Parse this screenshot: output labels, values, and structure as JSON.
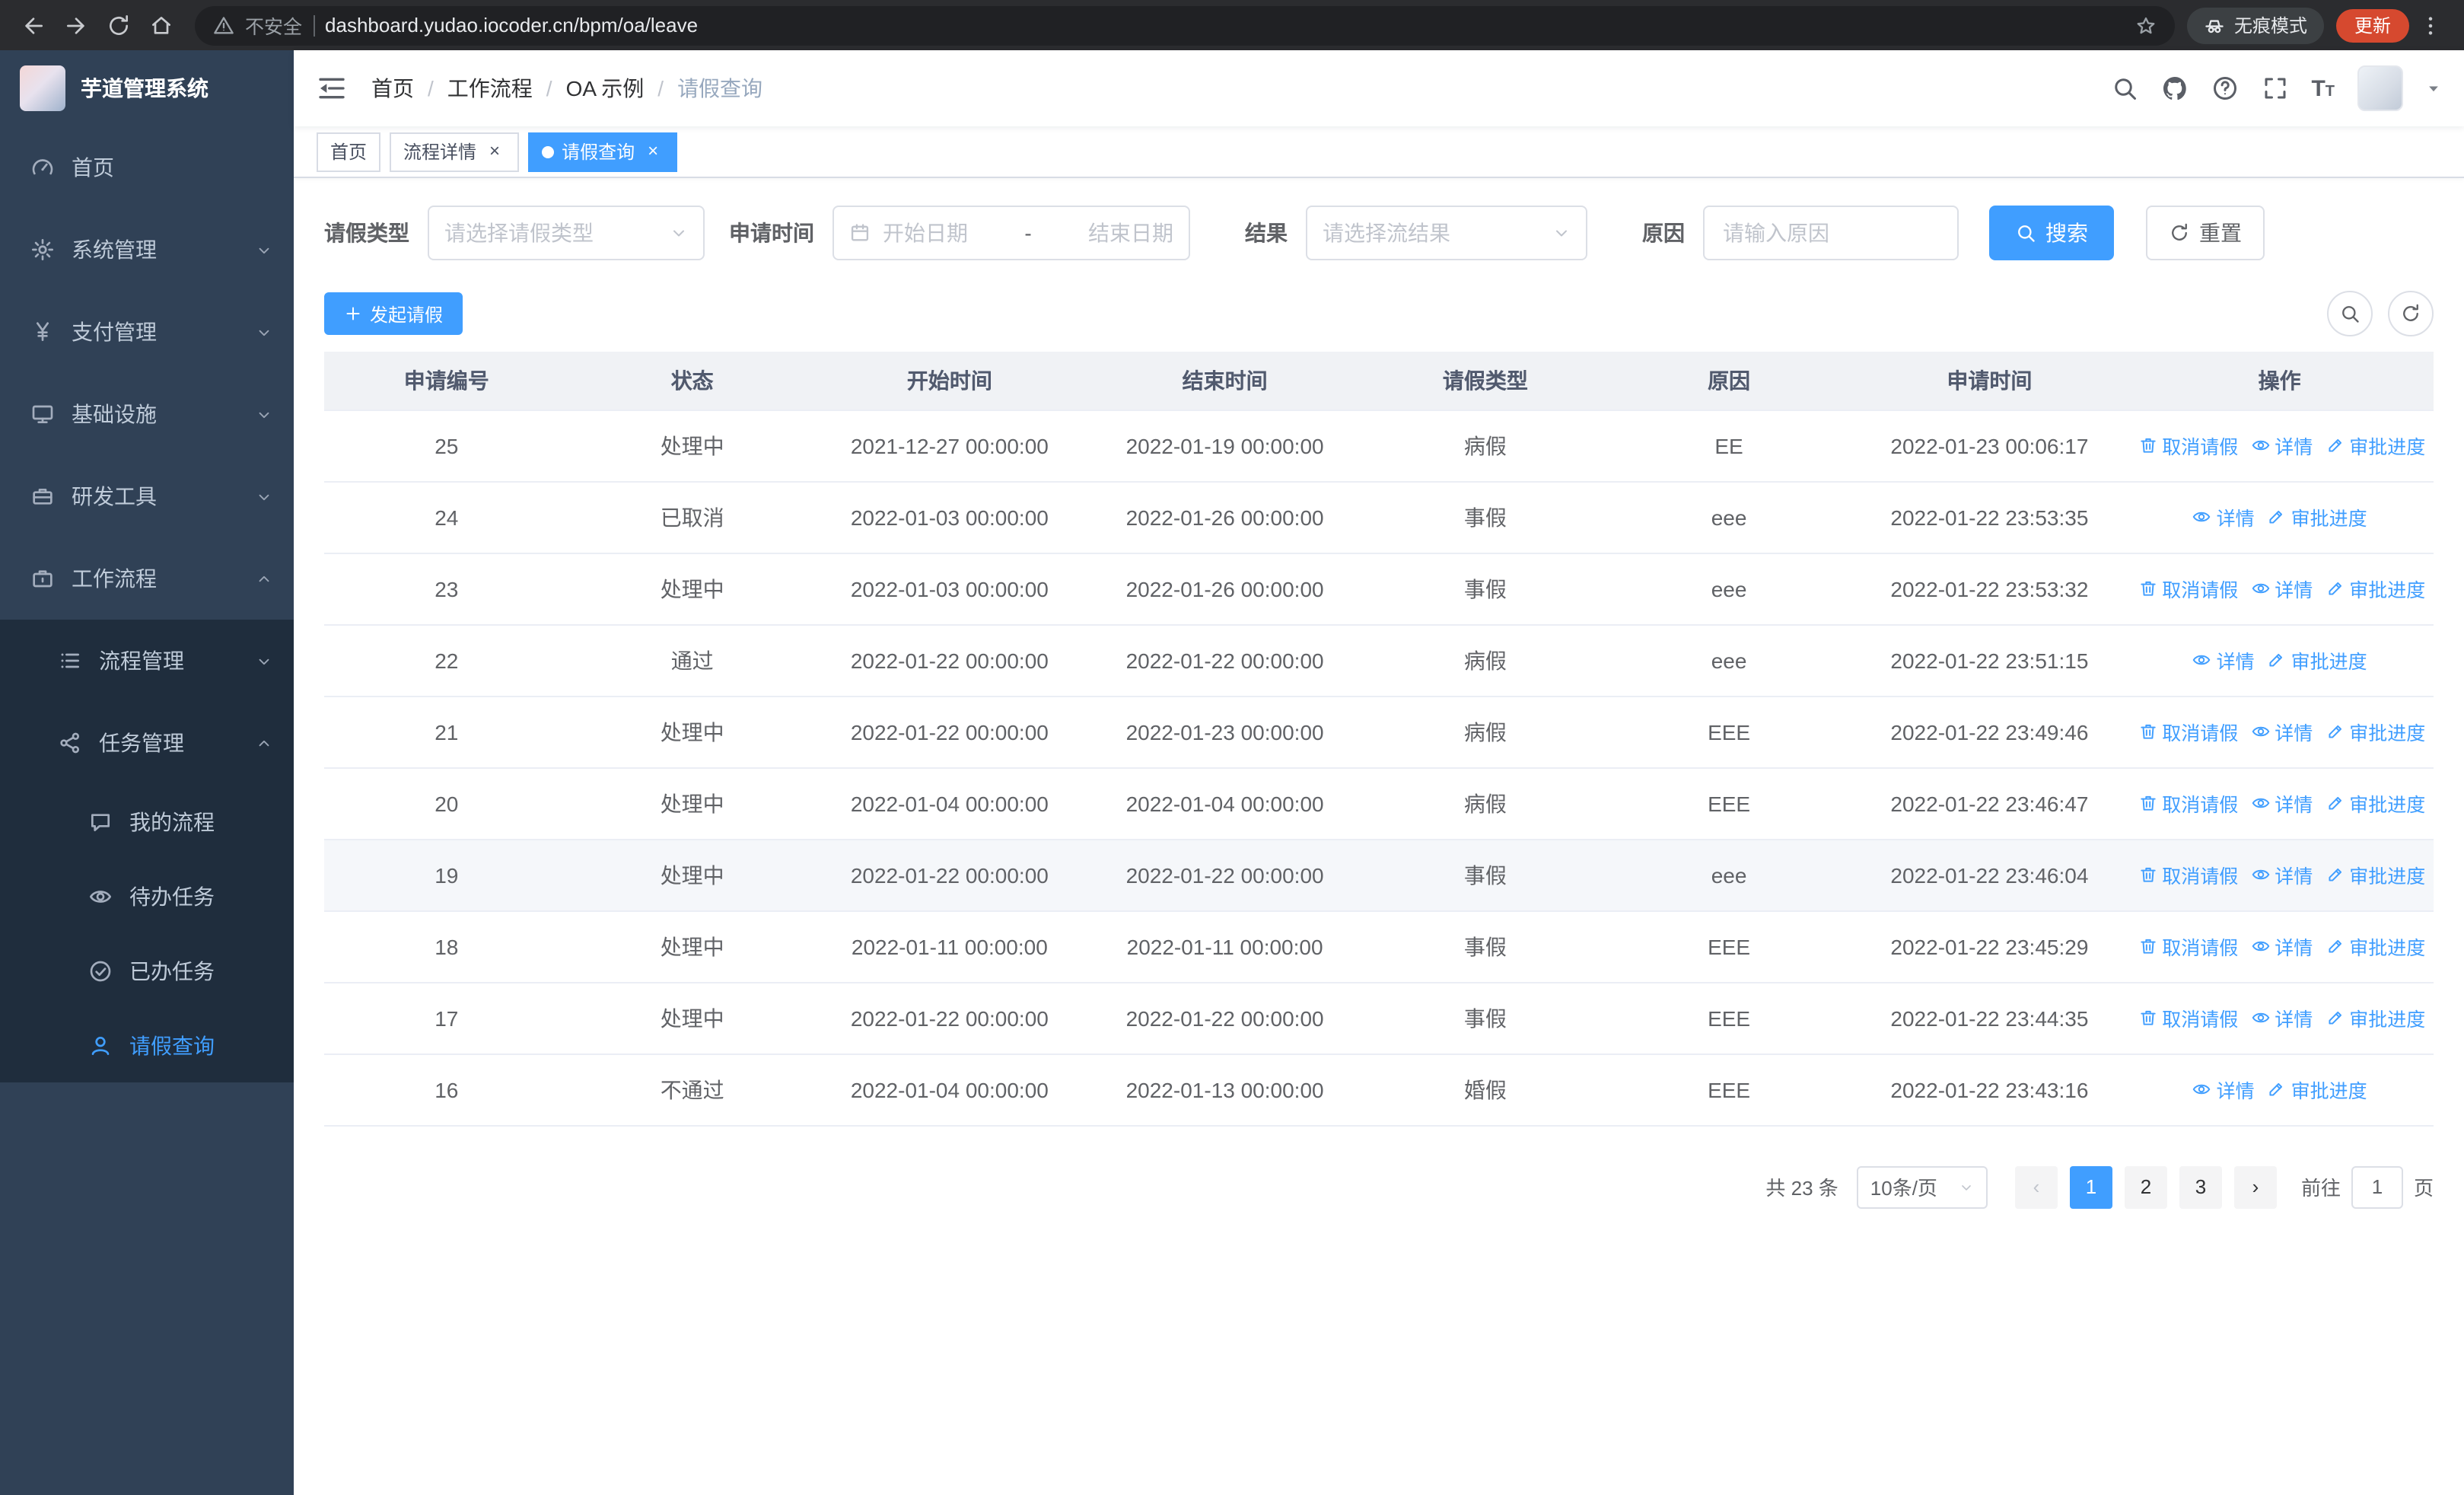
{
  "browser": {
    "security_label": "不安全",
    "url": "dashboard.yudao.iocoder.cn/bpm/oa/leave",
    "incognito_label": "无痕模式",
    "update_label": "更新"
  },
  "glyphs": {
    "close": "×",
    "breadcrumb_separator": "/",
    "prev_page": "‹",
    "next_page": "›",
    "font_size_large": "T",
    "font_size_small": "T"
  },
  "colors": {
    "accent": "#409EFF",
    "sidebar_bg": "#304156",
    "submenu_bg": "#1f2d3d",
    "update_pill_bg": "#d6492f",
    "table_header_bg": "#f0f2f5"
  },
  "icons": {
    "browser": [
      "back-arrow-icon",
      "forward-arrow-icon",
      "reload-icon",
      "home-icon",
      "warning-triangle-icon",
      "bookmark-star-icon",
      "incognito-icon",
      "kebab-menu-icon"
    ],
    "navbar": [
      "sidebar-toggle-icon",
      "search-icon",
      "github-icon",
      "question-icon",
      "fullscreen-icon",
      "font-size-icon",
      "chevron-down-icon"
    ],
    "table_actions": [
      "trash-icon",
      "eye-icon",
      "edit-icon"
    ]
  },
  "sidebar": {
    "title": "芋道管理系统",
    "items": [
      {
        "label": "首页",
        "icon": "dashboard-icon"
      },
      {
        "label": "系统管理",
        "icon": "gear-icon"
      },
      {
        "label": "支付管理",
        "icon": "yen-icon"
      },
      {
        "label": "基础设施",
        "icon": "monitor-icon"
      },
      {
        "label": "研发工具",
        "icon": "toolbox-icon"
      },
      {
        "label": "工作流程",
        "icon": "briefcase-icon",
        "expanded": true
      }
    ],
    "workflow_children": [
      {
        "label": "流程管理",
        "icon": "list-icon"
      },
      {
        "label": "任务管理",
        "icon": "share-icon",
        "expanded": true
      }
    ],
    "task_children": [
      {
        "label": "我的流程",
        "icon": "chat-icon"
      },
      {
        "label": "待办任务",
        "icon": "eye-icon"
      },
      {
        "label": "已办任务",
        "icon": "check-circle-icon"
      },
      {
        "label": "请假查询",
        "icon": "user-icon",
        "active": true
      }
    ]
  },
  "header": {
    "breadcrumb": [
      "首页",
      "工作流程",
      "OA 示例",
      "请假查询"
    ]
  },
  "tabs": [
    {
      "label": "首页",
      "closable": false,
      "active": false
    },
    {
      "label": "流程详情",
      "closable": true,
      "active": false
    },
    {
      "label": "请假查询",
      "closable": true,
      "active": true
    }
  ],
  "filters": {
    "leave_type_label": "请假类型",
    "leave_type_placeholder": "请选择请假类型",
    "apply_time_label": "申请时间",
    "start_date_placeholder": "开始日期",
    "range_separator": "-",
    "end_date_placeholder": "结束日期",
    "result_label": "结果",
    "result_placeholder": "请选择流结果",
    "reason_label": "原因",
    "reason_placeholder": "请输入原因",
    "search_button": "搜索",
    "reset_button": "重置"
  },
  "toolbar": {
    "create_button": "发起请假"
  },
  "table": {
    "columns": [
      "申请编号",
      "状态",
      "开始时间",
      "结束时间",
      "请假类型",
      "原因",
      "申请时间",
      "操作"
    ],
    "actions": {
      "cancel": "取消请假",
      "detail": "详情",
      "progress": "审批进度"
    },
    "rows": [
      {
        "id": "25",
        "status": "处理中",
        "start": "2021-12-27 00:00:00",
        "end": "2022-01-19 00:00:00",
        "type": "病假",
        "reason": "EE",
        "applied": "2022-01-23 00:06:17",
        "cancellable": true,
        "highlighted": false
      },
      {
        "id": "24",
        "status": "已取消",
        "start": "2022-01-03 00:00:00",
        "end": "2022-01-26 00:00:00",
        "type": "事假",
        "reason": "eee",
        "applied": "2022-01-22 23:53:35",
        "cancellable": false,
        "highlighted": false
      },
      {
        "id": "23",
        "status": "处理中",
        "start": "2022-01-03 00:00:00",
        "end": "2022-01-26 00:00:00",
        "type": "事假",
        "reason": "eee",
        "applied": "2022-01-22 23:53:32",
        "cancellable": true,
        "highlighted": false
      },
      {
        "id": "22",
        "status": "通过",
        "start": "2022-01-22 00:00:00",
        "end": "2022-01-22 00:00:00",
        "type": "病假",
        "reason": "eee",
        "applied": "2022-01-22 23:51:15",
        "cancellable": false,
        "highlighted": false
      },
      {
        "id": "21",
        "status": "处理中",
        "start": "2022-01-22 00:00:00",
        "end": "2022-01-23 00:00:00",
        "type": "病假",
        "reason": "EEE",
        "applied": "2022-01-22 23:49:46",
        "cancellable": true,
        "highlighted": false
      },
      {
        "id": "20",
        "status": "处理中",
        "start": "2022-01-04 00:00:00",
        "end": "2022-01-04 00:00:00",
        "type": "病假",
        "reason": "EEE",
        "applied": "2022-01-22 23:46:47",
        "cancellable": true,
        "highlighted": false
      },
      {
        "id": "19",
        "status": "处理中",
        "start": "2022-01-22 00:00:00",
        "end": "2022-01-22 00:00:00",
        "type": "事假",
        "reason": "eee",
        "applied": "2022-01-22 23:46:04",
        "cancellable": true,
        "highlighted": true
      },
      {
        "id": "18",
        "status": "处理中",
        "start": "2022-01-11 00:00:00",
        "end": "2022-01-11 00:00:00",
        "type": "事假",
        "reason": "EEE",
        "applied": "2022-01-22 23:45:29",
        "cancellable": true,
        "highlighted": false
      },
      {
        "id": "17",
        "status": "处理中",
        "start": "2022-01-22 00:00:00",
        "end": "2022-01-22 00:00:00",
        "type": "事假",
        "reason": "EEE",
        "applied": "2022-01-22 23:44:35",
        "cancellable": true,
        "highlighted": false
      },
      {
        "id": "16",
        "status": "不通过",
        "start": "2022-01-04 00:00:00",
        "end": "2022-01-13 00:00:00",
        "type": "婚假",
        "reason": "EEE",
        "applied": "2022-01-22 23:43:16",
        "cancellable": false,
        "highlighted": false
      }
    ]
  },
  "pagination": {
    "total": "共 23 条",
    "page_size": "10条/页",
    "pages": [
      "1",
      "2",
      "3"
    ],
    "active_page": "1",
    "goto_label": "前往",
    "goto_value": "1",
    "goto_suffix": "页"
  }
}
